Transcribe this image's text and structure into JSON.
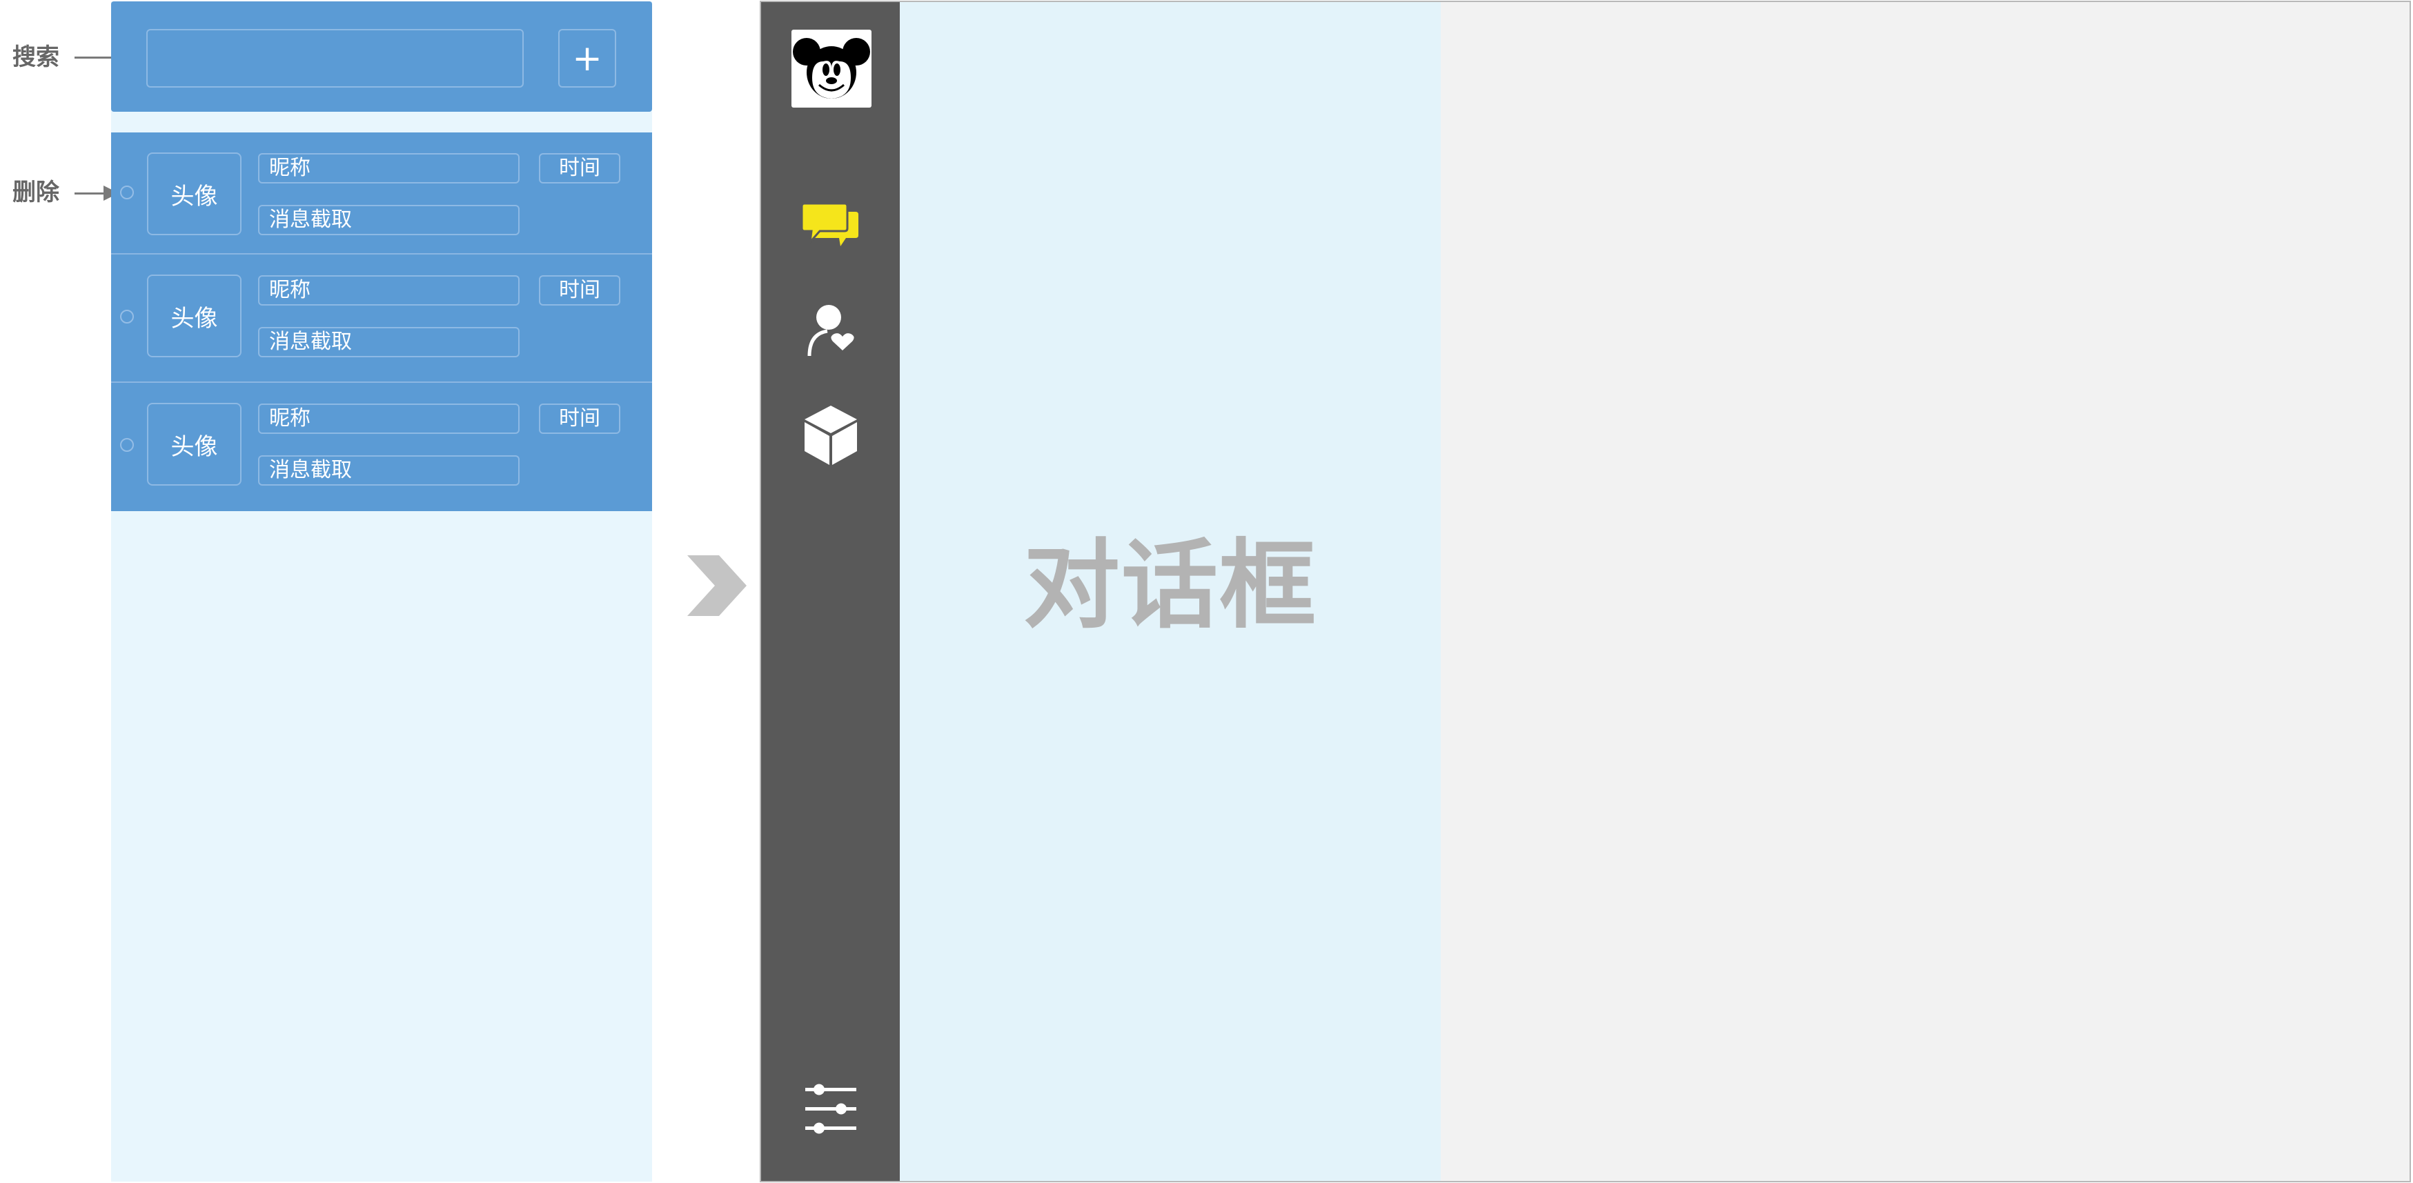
{
  "annotations": {
    "search_label": "搜索",
    "delete_label": "删除"
  },
  "search": {
    "value": "",
    "placeholder": "",
    "add_label": "+"
  },
  "conversations": [
    {
      "avatar": "头像",
      "nickname": "昵称",
      "time": "时间",
      "snippet": "消息截取"
    },
    {
      "avatar": "头像",
      "nickname": "昵称",
      "time": "时间",
      "snippet": "消息截取"
    },
    {
      "avatar": "头像",
      "nickname": "昵称",
      "time": "时间",
      "snippet": "消息截取"
    }
  ],
  "sidebar": {
    "avatar_icon": "mickey-mouse-icon",
    "items": [
      {
        "icon": "chat-bubbles-icon",
        "active": true
      },
      {
        "icon": "contacts-icon",
        "active": false
      },
      {
        "icon": "cube-icon",
        "active": false
      }
    ],
    "settings_icon": "settings-sliders-icon"
  },
  "chat": {
    "title": "对话框"
  },
  "colors": {
    "list_blue": "#5b9bd5",
    "list_background": "#e8f6fd",
    "sidebar_dark": "#595959",
    "chat_background": "#e3f3fa",
    "app_background": "#f2f2f2",
    "active_icon_yellow": "#f5e51b",
    "title_gray": "#b3b3b3"
  }
}
